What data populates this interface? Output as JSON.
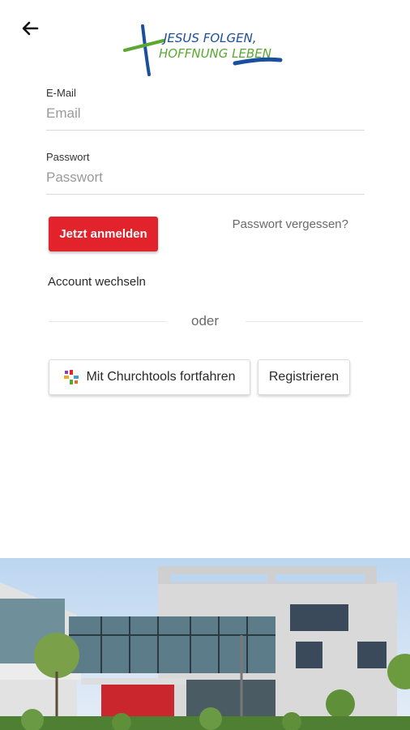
{
  "header": {
    "back_icon": "arrow-left-icon",
    "logo_icon": "cross-logo-icon"
  },
  "logo": {
    "line1": "JESUS FOLGEN,",
    "line2": "HOFFNUNG LEBEN"
  },
  "form": {
    "email_label": "E-Mail",
    "email_placeholder": "Email",
    "password_label": "Passwort",
    "password_placeholder": "Passwort"
  },
  "actions": {
    "login_label": "Jetzt anmelden",
    "forgot_label": "Passwort vergessen?",
    "switch_account_label": "Account wechseln",
    "divider_text": "oder",
    "churchtools_label": "Mit Churchtools fortfahren",
    "churchtools_icon": "churchtools-icon",
    "register_label": "Registrieren"
  },
  "colors": {
    "primary": "#e3232b",
    "logo_blue": "#1a4f9e",
    "logo_green": "#5aa831"
  }
}
